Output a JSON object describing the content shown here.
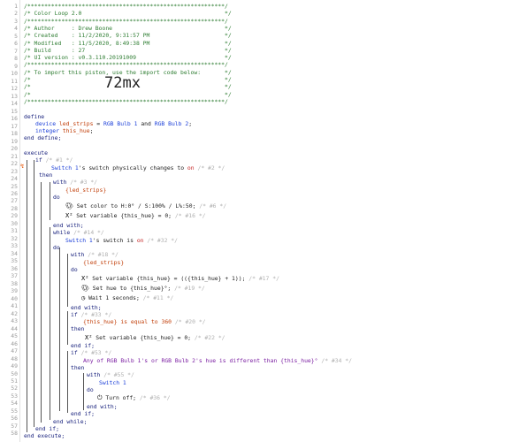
{
  "header": [
    "/**********************************************************/",
    "/* Color Loop 2.0                                          */",
    "/**********************************************************/",
    "/* Author     : Drew Boone                                 */",
    "/* Created    : 11/2/2020, 9:31:57 PM                      */",
    "/* Modified   : 11/5/2020, 8:49:38 PM                      */",
    "/* Build      : 27                                         */",
    "/* UI version : v0.3.110.20191009                          */",
    "/**********************************************************/",
    "/* To import this piston, use the import code below:       */",
    "/*                                                         */",
    "/*                                                         */",
    "/*                                                         */",
    "/**********************************************************/"
  ],
  "import_code": "72mx",
  "define": {
    "kw_define": "define",
    "device_line_kw": "device",
    "device_var": "led_strips",
    "eq": " = ",
    "dev1": "RGB Bulb 1",
    "and": " and ",
    "dev2": "RGB Bulb 2",
    "semi": ";",
    "int_kw": "integer",
    "int_var": "this_hue",
    "end_define": "end define;"
  },
  "execute": {
    "kw": "execute",
    "if1": "if",
    "if1_c": "/* #1 */",
    "switch_dev": "Switch 1",
    "switch_txt": "'s switch physically changes to ",
    "on": "on",
    "c2": "/* #2 */",
    "then": "then",
    "with": "with",
    "c3": "/* #3 */",
    "led": "{led_strips}",
    "do": "do",
    "set_color": "Set color to H:0° / S:100% / L%:50;",
    "c6": "/* #6 */",
    "set_var0": "Set variable {this_hue} = 0;",
    "c16": "/* #16 */",
    "end_with": "end with;",
    "while": "while",
    "c14": "/* #14 */",
    "sw_is": "'s switch is ",
    "c32": "/* #32 */",
    "c18": "/* #18 */",
    "set_var_inc": "Set variable {this_hue} = (({this_hue} + 1));",
    "c17": "/* #17 */",
    "set_hue": "Set hue to {this_hue}°;",
    "c19": "/* #19 */",
    "wait": "Wait 1 seconds;",
    "c11": "/* #11 */",
    "if2": "if",
    "c33": "/* #33 */",
    "hue_eq": "{this_hue} is equal to 360",
    "c20": "/* #20 */",
    "set_var0b": "Set variable {this_hue} = 0;",
    "c22": "/* #22 */",
    "end_if": "end if;",
    "c53": "/* #53 */",
    "any_of": "Any of RGB Bulb 1's or RGB Bulb 2's hue is different than {this_hue}°",
    "c34": "/* #34 */",
    "c55": "/* #55 */",
    "switch_b": "Switch 1",
    "turn_off": "Turn off;",
    "c36": "/* #36 */",
    "end_while": "end while;",
    "end_if2": "end if;",
    "end_execute": "end execute;"
  },
  "line_numbers": [
    "1",
    "2",
    "3",
    "4",
    "5",
    "6",
    "7",
    "8",
    "9",
    "10",
    "11",
    "12",
    "13",
    "14",
    "15",
    "16",
    "17",
    "18",
    "19",
    "20",
    "21",
    "22",
    "23",
    "24",
    "25",
    "26",
    "27",
    "28",
    "29",
    "30",
    "31",
    "32",
    "33",
    "34",
    "35",
    "36",
    "37",
    "38",
    "39",
    "40",
    "41",
    "42",
    "43",
    "44",
    "45",
    "46",
    "47",
    "48",
    "49",
    "50",
    "51",
    "52",
    "53",
    "54",
    "55",
    "56",
    "57",
    "58"
  ]
}
